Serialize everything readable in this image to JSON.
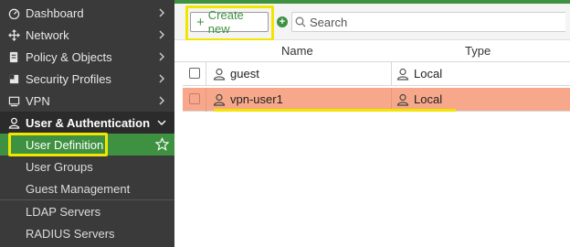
{
  "sidebar": {
    "items": [
      {
        "label": "Dashboard",
        "icon": "dashboard-icon",
        "has_chevron": true
      },
      {
        "label": "Network",
        "icon": "network-icon",
        "has_chevron": true
      },
      {
        "label": "Policy & Objects",
        "icon": "policy-icon",
        "has_chevron": true
      },
      {
        "label": "Security Profiles",
        "icon": "shield-icon",
        "has_chevron": true
      },
      {
        "label": "VPN",
        "icon": "monitor-icon",
        "has_chevron": true
      },
      {
        "label": "User & Authentication",
        "icon": "user-icon",
        "expanded": true
      }
    ],
    "subitems": [
      {
        "label": "User Definition",
        "selected": true
      },
      {
        "label": "User Groups"
      },
      {
        "label": "Guest Management"
      },
      {
        "label": "LDAP Servers"
      },
      {
        "label": "RADIUS Servers"
      }
    ]
  },
  "toolbar": {
    "create_label": "Create new",
    "search_placeholder": "Search"
  },
  "table": {
    "columns": [
      "Name",
      "Type"
    ],
    "rows": [
      {
        "name": "guest",
        "type": "Local",
        "selected": false
      },
      {
        "name": "vpn-user1",
        "type": "Local",
        "selected": true
      }
    ]
  },
  "colors": {
    "sidebar_bg": "#3a3a3a",
    "accent_green": "#3f9142",
    "highlight_yellow": "#f2e600",
    "selected_row": "#f7a88a"
  }
}
